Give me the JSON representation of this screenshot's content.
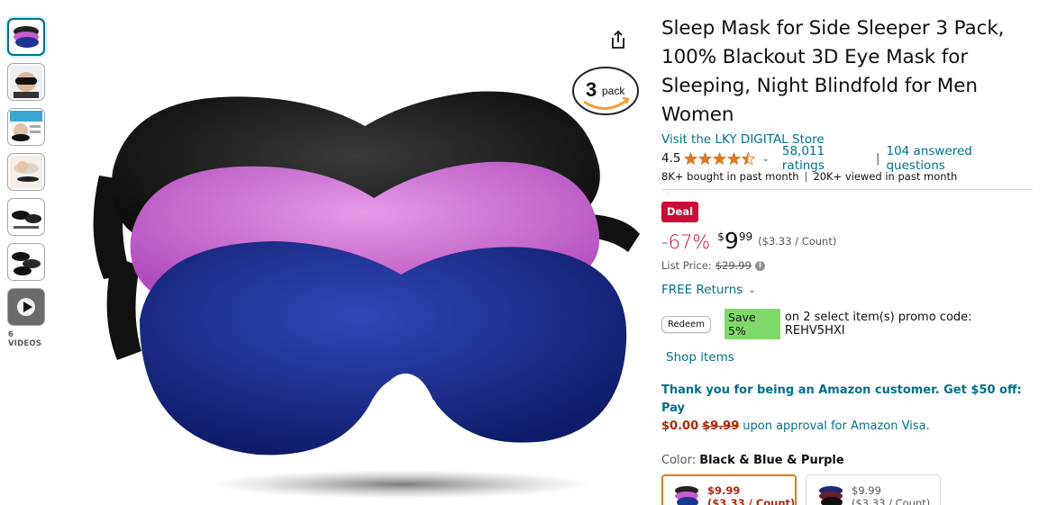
{
  "thumbnails": {
    "items": [
      "main-thumb",
      "man-wearing",
      "infographic",
      "woman-sleeping",
      "side-detail",
      "three-masks",
      "video"
    ],
    "videos_label": "6 VIDEOS"
  },
  "badge": {
    "pack_number": "3",
    "pack_label": "pack"
  },
  "product": {
    "title": "Sleep Mask for Side Sleeper 3 Pack, 100% Blackout 3D Eye Mask for Sleeping, Night Blindfold for Men Women",
    "store_link": "Visit the LKY DIGITAL Store",
    "rating": "4.5",
    "stars": 4.5,
    "ratings_count": "58,011 ratings",
    "answered": "104 answered questions",
    "bought": "8K+ bought in past month",
    "viewed": "20K+ viewed in past month"
  },
  "deal": {
    "badge": "Deal",
    "discount": "-67%",
    "currency": "$",
    "price_whole": "9",
    "price_fraction": "99",
    "unit_price": "($3.33 / Count)",
    "list_price_label": "List Price:",
    "list_price": "$29.99"
  },
  "returns": {
    "label": "FREE Returns"
  },
  "promo": {
    "redeem": "Redeem",
    "save": "Save 5%",
    "text": "on 2 select item(s) promo code: REHV5HXI",
    "shop_items": "Shop items"
  },
  "amazon_visa": {
    "line1": "Thank you for being an Amazon customer. Get $50 off: Pay",
    "new_price": "$0.00",
    "old_price": "$9.99",
    "rest": "upon approval for Amazon Visa."
  },
  "color": {
    "label": "Color:",
    "value": "Black & Blue & Purple",
    "options": [
      {
        "price": "$9.99",
        "unit": "($3.33 / Count)"
      },
      {
        "price": "$9.99",
        "unit": "($3.33 / Count)"
      }
    ]
  },
  "colors": {
    "link": "#007185",
    "deal_red": "#cc0c39",
    "price_red": "#b12704",
    "save_green": "#7fda69",
    "star_orange": "#de7921",
    "selected_border": "#e77600"
  }
}
